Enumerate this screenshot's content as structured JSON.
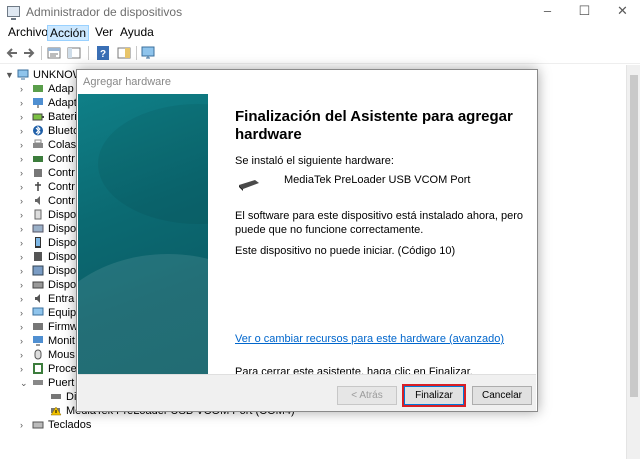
{
  "window": {
    "title": "Administrador de dispositivos",
    "minimize": "–",
    "maximize": "☐",
    "close": "✕"
  },
  "menu": [
    "Archivo",
    "Acción",
    "Ver",
    "Ayuda"
  ],
  "menu_active": "Acción",
  "toolbar": {
    "buttons": [
      "back-arrow-icon",
      "forward-arrow-icon",
      "properties-icon",
      "show-hide-console-icon",
      "help-icon",
      "action-pane-icon",
      "monitor-icon"
    ]
  },
  "tree": {
    "root": "UNKNOW",
    "items": [
      {
        "label": "Adap",
        "icon": "audio-icon",
        "expanded": false
      },
      {
        "label": "Adapt",
        "icon": "network-adapter-icon",
        "expanded": false
      },
      {
        "label": "Bateri",
        "icon": "battery-icon",
        "expanded": false
      },
      {
        "label": "Blueto",
        "icon": "bluetooth-icon",
        "expanded": false
      },
      {
        "label": "Colas",
        "icon": "print-queue-icon",
        "expanded": false
      },
      {
        "label": "Contr",
        "icon": "storage-controller-icon",
        "expanded": false
      },
      {
        "label": "Contr",
        "icon": "controller-icon",
        "expanded": false
      },
      {
        "label": "Contr",
        "icon": "usb-controller-icon",
        "expanded": false
      },
      {
        "label": "Contr",
        "icon": "sound-controller-icon",
        "expanded": false
      },
      {
        "label": "Dispo",
        "icon": "software-device-icon",
        "expanded": false
      },
      {
        "label": "Dispo",
        "icon": "hid-device-icon",
        "expanded": false
      },
      {
        "label": "Dispo",
        "icon": "portable-device-icon",
        "expanded": false
      },
      {
        "label": "Dispo",
        "icon": "memory-device-icon",
        "expanded": false
      },
      {
        "label": "Dispo",
        "icon": "system-device-icon",
        "expanded": false
      },
      {
        "label": "Dispo",
        "icon": "disk-drive-icon",
        "expanded": false
      },
      {
        "label": "Entra",
        "icon": "audio-io-icon",
        "expanded": false
      },
      {
        "label": "Equip",
        "icon": "computer-icon",
        "expanded": false
      },
      {
        "label": "Firmw",
        "icon": "firmware-icon",
        "expanded": false
      },
      {
        "label": "Monit",
        "icon": "monitor-icon",
        "expanded": false
      },
      {
        "label": "Mous",
        "icon": "mouse-icon",
        "expanded": false
      },
      {
        "label": "Proce",
        "icon": "processor-icon",
        "expanded": false
      },
      {
        "label": "Puert",
        "icon": "port-icon",
        "expanded": true
      },
      {
        "label": "Di",
        "icon": "port-device-icon",
        "child": true
      },
      {
        "label": "MediaTek PreLoader USB VCOM Port (COM4)",
        "icon": "warning-port-icon",
        "child": true
      },
      {
        "label": "Teclados",
        "icon": "keyboard-icon",
        "expanded": false
      }
    ]
  },
  "dialog": {
    "title": "Agregar hardware",
    "heading": "Finalización del Asistente para agregar hardware",
    "installed_label": "Se instaló el siguiente hardware:",
    "device_name": "MediaTek PreLoader USB VCOM Port",
    "status_line1": "El software para este dispositivo está instalado ahora, pero",
    "status_line2": "puede que no funcione correctamente.",
    "error_text": "Este dispositivo no puede iniciar. (Código 10)",
    "resources_link": "Ver o cambiar recursos para este hardware (avanzado)",
    "close_hint": "Para cerrar este asistente, haga clic en Finalizar.",
    "buttons": {
      "back": "< Atrás",
      "finish": "Finalizar",
      "cancel": "Cancelar"
    }
  },
  "colors": {
    "accent": "#0078d7",
    "highlight": "#d81f26",
    "sidebar": "#0b6a72"
  }
}
